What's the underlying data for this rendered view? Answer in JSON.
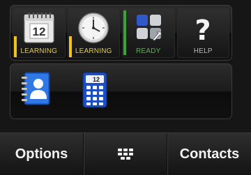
{
  "shortcuts": [
    {
      "icon": "calendar-icon",
      "date": "12",
      "label": "LEARNING",
      "status_color": "#f0c419",
      "label_color": "#e0c84e"
    },
    {
      "icon": "clock-icon",
      "label": "LEARNING",
      "status_color": "#f0c419",
      "label_color": "#e0c84e"
    },
    {
      "icon": "app-grid-icon",
      "label": "READY",
      "status_color": "#3aa33a",
      "label_color": "#57b64a"
    },
    {
      "icon": "help-icon",
      "label": "HELP",
      "label_color": "#b9b9b9"
    }
  ],
  "apps": [
    {
      "icon": "contacts-book-icon"
    },
    {
      "icon": "calculator-icon",
      "date": "12"
    }
  ],
  "softkeys": {
    "left": "Options",
    "middle_icon": "menu-grid-icon",
    "right": "Contacts"
  }
}
